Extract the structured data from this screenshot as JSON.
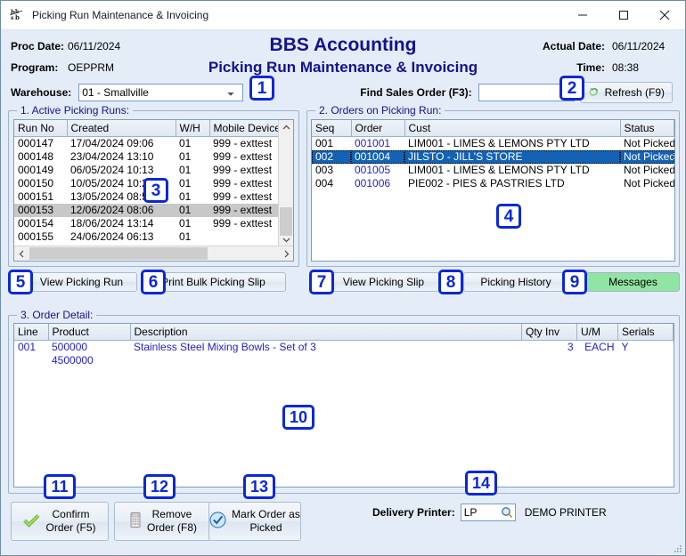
{
  "window": {
    "title": "Picking Run Maintenance & Invoicing",
    "icon": "bbs-logo-icon",
    "minimize": "minimize-icon",
    "maximize": "maximize-icon",
    "close": "close-icon"
  },
  "header": {
    "proc_date_label": "Proc Date:",
    "proc_date_value": "06/11/2024",
    "program_label": "Program:",
    "program_value": "OEPPRM",
    "actual_date_label": "Actual Date:",
    "actual_date_value": "06/11/2024",
    "time_label": "Time:",
    "time_value": "08:38",
    "app_title": "BBS Accounting",
    "app_subtitle": "Picking Run Maintenance & Invoicing",
    "warehouse_label": "Warehouse:",
    "warehouse_value": "01 - Smallville",
    "warehouse_options": [
      "01 - Smallville"
    ],
    "find_label": "Find Sales Order (F3):",
    "find_value": "",
    "find_placeholder": "",
    "refresh_label": "Refresh (F9)",
    "refresh_icon": "recycle-refresh-icon"
  },
  "panel1": {
    "legend": "1. Active Picking Runs:",
    "columns": [
      "Run No",
      "Created",
      "W/H",
      "Mobile Device"
    ],
    "rows": [
      {
        "run_no": "000147",
        "created": "17/04/2024 09:06",
        "wh": "01",
        "device": "999 - exttest",
        "selected": false
      },
      {
        "run_no": "000148",
        "created": "23/04/2024 13:10",
        "wh": "01",
        "device": "999 - exttest",
        "selected": false
      },
      {
        "run_no": "000149",
        "created": "06/05/2024 10:13",
        "wh": "01",
        "device": "999 - exttest",
        "selected": false
      },
      {
        "run_no": "000150",
        "created": "10/05/2024 10:21",
        "wh": "01",
        "device": "999 - exttest",
        "selected": false
      },
      {
        "run_no": "000151",
        "created": "13/05/2024 08:55",
        "wh": "01",
        "device": "999 - exttest",
        "selected": false
      },
      {
        "run_no": "000153",
        "created": "12/06/2024 08:06",
        "wh": "01",
        "device": "999 - exttest",
        "selected": true
      },
      {
        "run_no": "000154",
        "created": "18/06/2024 13:14",
        "wh": "01",
        "device": "999 - exttest",
        "selected": false
      },
      {
        "run_no": "000155",
        "created": "24/06/2024 06:13",
        "wh": "01",
        "device": "",
        "selected": false
      }
    ]
  },
  "panel2": {
    "legend": "2. Orders on Picking Run:",
    "columns": [
      "Seq",
      "Order",
      "Cust",
      "Status"
    ],
    "rows": [
      {
        "seq": "001",
        "order": "001001",
        "cust": "LIM001 - LIMES & LEMONS PTY LTD",
        "status": "Not Picked",
        "selected": false
      },
      {
        "seq": "002",
        "order": "001004",
        "cust": "JILSTO - JILL'S STORE",
        "status": "Not Picked",
        "selected": true
      },
      {
        "seq": "003",
        "order": "001005",
        "cust": "LIM001 - LIMES & LEMONS PTY LTD",
        "status": "Not Picked",
        "selected": false
      },
      {
        "seq": "004",
        "order": "001006",
        "cust": "PIE002 - PIES & PASTRIES LTD",
        "status": "Not Picked",
        "selected": false
      }
    ]
  },
  "panel3": {
    "legend": "3. Order Detail:",
    "columns": [
      "Line",
      "Product",
      "Description",
      "Qty Inv",
      "U/M",
      "Serials"
    ],
    "rows": [
      {
        "line": "001",
        "product": "500000",
        "product2": "4500000",
        "description": "Stainless Steel Mixing Bowls - Set of 3",
        "qty_inv": "3",
        "um": "EACH",
        "serials": "Y"
      }
    ]
  },
  "mid_buttons": {
    "view_picking_run": "View Picking Run",
    "print_bulk_picking_slip": "Print Bulk Picking Slip",
    "view_picking_slip": "View Picking Slip",
    "picking_history": "Picking History",
    "messages": "Messages",
    "messages_color": "#90e5a3"
  },
  "bottom_buttons": {
    "confirm_line1": "Confirm",
    "confirm_line2": "Order (F5)",
    "confirm_icon": "green-check-icon",
    "remove_line1": "Remove",
    "remove_line2": "Order (F8)",
    "remove_icon": "shredder-icon",
    "mark_line1": "Mark Order as",
    "mark_line2": "Picked",
    "mark_icon": "blue-check-circle-icon"
  },
  "printer": {
    "label": "Delivery Printer:",
    "value": "LP",
    "lookup_icon": "magnifier-icon",
    "description": "DEMO PRINTER"
  },
  "badges": [
    {
      "n": "1"
    },
    {
      "n": "2"
    },
    {
      "n": "3"
    },
    {
      "n": "4"
    },
    {
      "n": "5"
    },
    {
      "n": "6"
    },
    {
      "n": "7"
    },
    {
      "n": "8"
    },
    {
      "n": "9"
    },
    {
      "n": "10"
    },
    {
      "n": "11"
    },
    {
      "n": "12"
    },
    {
      "n": "13"
    },
    {
      "n": "14"
    }
  ]
}
